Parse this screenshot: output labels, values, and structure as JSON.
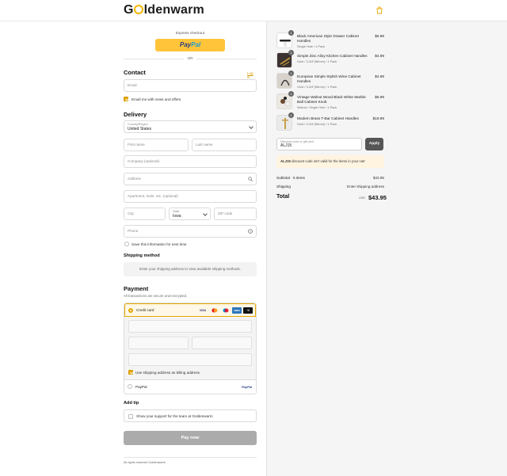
{
  "brand": {
    "logo_left": "G",
    "logo_right": "ldenwarm",
    "accent": "#e5a800"
  },
  "express": {
    "label": "Express checkout",
    "paypal_pay": "Pay",
    "paypal_pal": "Pal",
    "or": "OR"
  },
  "contact": {
    "heading": "Contact",
    "login_link": "Log in",
    "email_placeholder": "Email",
    "newsletter_label": "Email me with news and offers",
    "newsletter_checked": true
  },
  "delivery": {
    "heading": "Delivery",
    "country_label": "Country/Region",
    "country_value": "United States",
    "first_name_placeholder": "First name",
    "last_name_placeholder": "Last name",
    "company_placeholder": "Company (optional)",
    "address_placeholder": "Address",
    "apartment_placeholder": "Apartment, suite, etc. (optional)",
    "city_placeholder": "City",
    "state_label": "State",
    "state_value": "Iowa",
    "zip_placeholder": "ZIP code",
    "phone_placeholder": "Phone",
    "save_info_label": "Save this information for next time"
  },
  "shipping_method": {
    "heading": "Shipping method",
    "notice": "Enter your shipping address to view available shipping methods."
  },
  "payment": {
    "heading": "Payment",
    "subtitle": "All transactions are secure and encrypted.",
    "credit_card_label": "Credit card",
    "card_logos": [
      "VISA",
      "mastercard",
      "maestro",
      "AMEX",
      "+8"
    ],
    "billing_same_label": "Use shipping address as billing address",
    "paypal_label": "PayPal",
    "paypal_logo": "PayPal"
  },
  "tip": {
    "heading": "Add tip",
    "label": "Show your support for the team at Goldenwarm"
  },
  "pay_now_label": "Pay now",
  "footer": "All rights reserved Goldenwarm",
  "order": {
    "items": [
      {
        "name": "Black American Style Drawer Cabinet Handles",
        "variant": "Single Hole / 1 Pack",
        "qty": "1",
        "price": "$6.99"
      },
      {
        "name": "Simple Zinc Alloy Kitchen Cabinet Handles",
        "variant": "Gold / 3-3/4\"(96mm) / 1 Pack",
        "qty": "1",
        "price": "$4.99"
      },
      {
        "name": "European Simple Stylish Wine Cabinet Handles",
        "variant": "Gold / 3-3/4\"(96mm) / 1 Pack",
        "qty": "1",
        "price": "$4.99"
      },
      {
        "name": "Vintage Walnut Wood Black White Marble Ball Cabinet Knob",
        "variant": "Walnut / Single Hole / 1 Pack",
        "qty": "1",
        "price": "$6.99"
      },
      {
        "name": "Modern Brass T-Bar Cabinet Handles",
        "variant": "Gold / 3-3/4\"(96mm) / 1 Pack",
        "qty": "1",
        "price": "$19.99"
      }
    ],
    "discount_label": "Discount code or gift card",
    "discount_value": "ALJ15",
    "apply_label": "Apply",
    "alert_code": "ALJ15",
    "alert_text": " discount code isn't valid for the items in your cart",
    "subtotal_label": "Subtotal · 5 items",
    "subtotal_value": "$43.95",
    "shipping_label": "Shipping",
    "shipping_value": "Enter shipping address",
    "total_label": "Total",
    "total_currency": "USD",
    "total_value": "$43.95"
  }
}
